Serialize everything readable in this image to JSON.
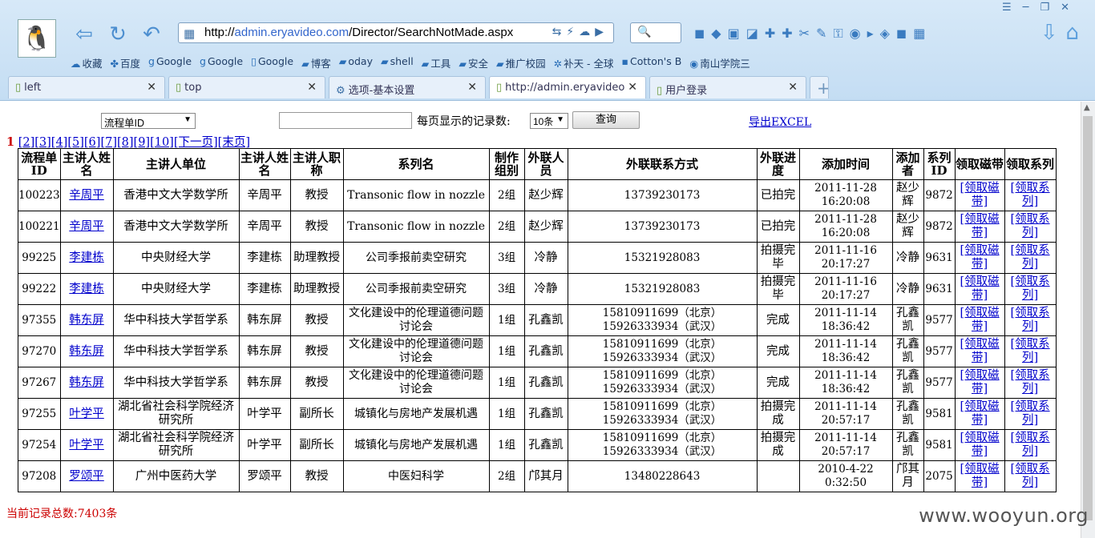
{
  "browser": {
    "url_scheme": "http://",
    "url_host": "admin.eryavideo.com",
    "url_path": "/Director/SearchNotMade.aspx",
    "bookmarks": [
      "收藏",
      "百度",
      "Google",
      "Google",
      "Google",
      "博客",
      "oday",
      "shell",
      "工具",
      "安全",
      "推广校园",
      "补天 - 全球",
      "Cotton's B",
      "南山学院三"
    ],
    "tabs": [
      {
        "label": "left",
        "active": false
      },
      {
        "label": "top",
        "active": false
      },
      {
        "label": "选项-基本设置",
        "active": false
      },
      {
        "label": "http://admin.eryavideo",
        "active": true
      },
      {
        "label": "用户登录",
        "active": false
      }
    ]
  },
  "search": {
    "field_selected": "流程单ID",
    "keyword": "",
    "per_page_label": "每页显示的记录数:",
    "per_page_selected": "10条",
    "query_label": "查询",
    "export_label": "导出EXCEL"
  },
  "pager": {
    "current": "1",
    "pages": [
      "[2]",
      "[3]",
      "[4]",
      "[5]",
      "[6]",
      "[7]",
      "[8]",
      "[9]",
      "[10]",
      "[下一页]",
      "[末页]"
    ]
  },
  "table": {
    "headers": [
      "流程单ID",
      "主讲人姓名",
      "主讲人单位",
      "主讲人姓名",
      "主讲人职称",
      "系列名",
      "制作组别",
      "外联人员",
      "外联联系方式",
      "外联进度",
      "添加时间",
      "添加者",
      "系列ID",
      "领取磁带",
      "领取系列"
    ],
    "action_tape": "[领取磁带]",
    "action_series": "[领取系列]",
    "rows": [
      {
        "id": "100223",
        "speaker": "辛周平",
        "unit": "香港中文大学数学所",
        "speaker2": "辛周平",
        "title": "教授",
        "series": "Transonic flow in nozzle",
        "group": "2组",
        "liaison": "赵少辉",
        "contact": "13739230173",
        "progress": "已拍完",
        "added": "2011-11-28 16:20:08",
        "adder": "赵少辉",
        "series_id": "9872"
      },
      {
        "id": "100221",
        "speaker": "辛周平",
        "unit": "香港中文大学数学所",
        "speaker2": "辛周平",
        "title": "教授",
        "series": "Transonic flow in nozzle",
        "group": "2组",
        "liaison": "赵少辉",
        "contact": "13739230173",
        "progress": "已拍完",
        "added": "2011-11-28 16:20:08",
        "adder": "赵少辉",
        "series_id": "9872"
      },
      {
        "id": "99225",
        "speaker": "李建栋",
        "unit": "中央财经大学",
        "speaker2": "李建栋",
        "title": "助理教授",
        "series": "公司季报前卖空研究",
        "group": "3组",
        "liaison": "冷静",
        "contact": "15321928083",
        "progress": "拍摄完毕",
        "added": "2011-11-16 20:17:27",
        "adder": "冷静",
        "series_id": "9631"
      },
      {
        "id": "99222",
        "speaker": "李建栋",
        "unit": "中央财经大学",
        "speaker2": "李建栋",
        "title": "助理教授",
        "series": "公司季报前卖空研究",
        "group": "3组",
        "liaison": "冷静",
        "contact": "15321928083",
        "progress": "拍摄完毕",
        "added": "2011-11-16 20:17:27",
        "adder": "冷静",
        "series_id": "9631"
      },
      {
        "id": "97355",
        "speaker": "韩东屏",
        "unit": "华中科技大学哲学系",
        "speaker2": "韩东屏",
        "title": "教授",
        "series": "文化建设中的伦理道德问题讨论会",
        "group": "1组",
        "liaison": "孔鑫凯",
        "contact": "15810911699（北京）15926333934（武汉）",
        "progress": "完成",
        "added": "2011-11-14 18:36:42",
        "adder": "孔鑫凯",
        "series_id": "9577"
      },
      {
        "id": "97270",
        "speaker": "韩东屏",
        "unit": "华中科技大学哲学系",
        "speaker2": "韩东屏",
        "title": "教授",
        "series": "文化建设中的伦理道德问题讨论会",
        "group": "1组",
        "liaison": "孔鑫凯",
        "contact": "15810911699（北京）15926333934（武汉）",
        "progress": "完成",
        "added": "2011-11-14 18:36:42",
        "adder": "孔鑫凯",
        "series_id": "9577"
      },
      {
        "id": "97267",
        "speaker": "韩东屏",
        "unit": "华中科技大学哲学系",
        "speaker2": "韩东屏",
        "title": "教授",
        "series": "文化建设中的伦理道德问题讨论会",
        "group": "1组",
        "liaison": "孔鑫凯",
        "contact": "15810911699（北京）15926333934（武汉）",
        "progress": "完成",
        "added": "2011-11-14 18:36:42",
        "adder": "孔鑫凯",
        "series_id": "9577"
      },
      {
        "id": "97255",
        "speaker": "叶学平",
        "unit": "湖北省社会科学院经济研究所",
        "speaker2": "叶学平",
        "title": "副所长",
        "series": "城镇化与房地产发展机遇",
        "group": "1组",
        "liaison": "孔鑫凯",
        "contact": "15810911699（北京）15926333934（武汉）",
        "progress": "拍摄完成",
        "added": "2011-11-14 20:57:17",
        "adder": "孔鑫凯",
        "series_id": "9581"
      },
      {
        "id": "97254",
        "speaker": "叶学平",
        "unit": "湖北省社会科学院经济研究所",
        "speaker2": "叶学平",
        "title": "副所长",
        "series": "城镇化与房地产发展机遇",
        "group": "1组",
        "liaison": "孔鑫凯",
        "contact": "15810911699（北京）15926333934（武汉）",
        "progress": "拍摄完成",
        "added": "2011-11-14 20:57:17",
        "adder": "孔鑫凯",
        "series_id": "9581"
      },
      {
        "id": "97208",
        "speaker": "罗颂平",
        "unit": "广州中医药大学",
        "speaker2": "罗颂平",
        "title": "教授",
        "series": "中医妇科学",
        "group": "2组",
        "liaison": "邝其月",
        "contact": "13480228643",
        "progress": "",
        "added": "2010-4-22 0:32:50",
        "adder": "邝其月",
        "series_id": "2075"
      }
    ]
  },
  "footer": {
    "total": "当前记录总数:7403条",
    "watermark": "www.wooyun.org"
  }
}
